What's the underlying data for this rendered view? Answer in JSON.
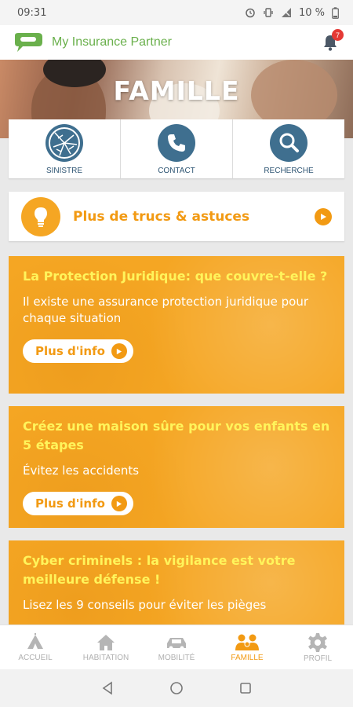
{
  "status": {
    "time": "09:31",
    "battery": "10 %"
  },
  "app": {
    "title": "My Insurance Partner",
    "notification_count": "7",
    "brand_color": "#6ab04c"
  },
  "hero": {
    "title": "FAMILLE"
  },
  "quick_actions": [
    {
      "label": "SINISTRE",
      "icon": "broken-glass-icon"
    },
    {
      "label": "CONTACT",
      "icon": "phone-icon"
    },
    {
      "label": "RECHERCHE",
      "icon": "search-icon"
    }
  ],
  "tips": {
    "label": "Plus de trucs & astuces",
    "icon": "lightbulb-icon"
  },
  "articles": [
    {
      "title": "La Protection Juridique: que couvre-t-elle ?",
      "desc": "Il existe une assurance protection juridique pour chaque situation",
      "button": "Plus d'info"
    },
    {
      "title": "Créez une maison sûre pour vos enfants en 5 étapes",
      "desc": "Évitez les accidents",
      "button": "Plus d'info"
    },
    {
      "title": "Cyber criminels : la vigilance est votre meilleure défense !",
      "desc": "Lisez les 9 conseils pour éviter les pièges"
    }
  ],
  "bottom_nav": [
    {
      "label": "ACCUEIL",
      "icon": "home-tent-icon",
      "active": false
    },
    {
      "label": "HABITATION",
      "icon": "house-icon",
      "active": false
    },
    {
      "label": "MOBILITÉ",
      "icon": "car-icon",
      "active": false
    },
    {
      "label": "FAMILLE",
      "icon": "family-icon",
      "active": true
    },
    {
      "label": "PROFIL",
      "icon": "gear-icon",
      "active": false
    }
  ],
  "colors": {
    "accent": "#f29a13",
    "card": "#f5a623",
    "card_title": "#fff45b",
    "quick_icon_bg": "#3f6f8f"
  }
}
